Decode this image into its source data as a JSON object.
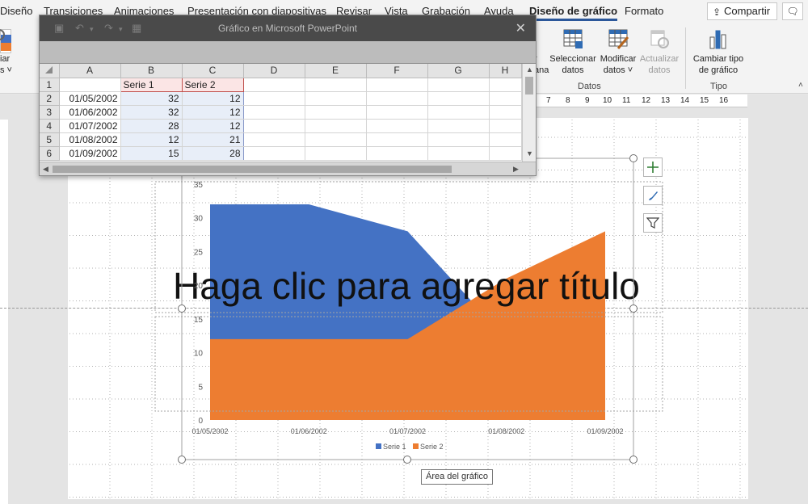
{
  "ribbon_tabs": [
    "Diseño",
    "Transiciones",
    "Animaciones",
    "Presentación con diapositivas",
    "Revisar",
    "Vista",
    "Grabación",
    "Ayuda",
    "Diseño de gráfico",
    "Formato"
  ],
  "active_tab": "Diseño de gráfico",
  "share_label": "Compartir",
  "ribbon": {
    "left_partial_label_1": "iar",
    "left_partial_label_2": "s ˅",
    "partial_label": "r",
    "partial_label_2": "ana",
    "select_data_label": "Seleccionar datos",
    "edit_data_label": "Modificar datos ˅",
    "refresh_data_label": "Actualizar datos",
    "data_group_label": "Datos",
    "change_type_label": "Cambiar tipo de gráfico",
    "type_group_label": "Tipo"
  },
  "ruler_numbers": [
    "7",
    "8",
    "9",
    "10",
    "11",
    "12",
    "13",
    "14",
    "15",
    "16"
  ],
  "spreadsheet": {
    "window_title": "Gráfico en Microsoft PowerPoint",
    "columns": [
      "A",
      "B",
      "C",
      "D",
      "E",
      "F",
      "G",
      "H"
    ],
    "row_numbers": [
      "1",
      "2",
      "3",
      "4",
      "5",
      "6"
    ],
    "header_row": [
      "",
      "Serie 1",
      "Serie 2"
    ],
    "rows": [
      [
        "01/05/2002",
        "32",
        "12"
      ],
      [
        "01/06/2002",
        "32",
        "12"
      ],
      [
        "01/07/2002",
        "28",
        "12"
      ],
      [
        "01/08/2002",
        "12",
        "21"
      ],
      [
        "01/09/2002",
        "15",
        "28"
      ]
    ]
  },
  "slide": {
    "title_placeholder": "Haga clic para agregar título",
    "chart_tooltip": "Área del gráfico"
  },
  "chart_data": {
    "type": "area",
    "categories": [
      "01/05/2002",
      "01/06/2002",
      "01/07/2002",
      "01/08/2002",
      "01/09/2002"
    ],
    "series": [
      {
        "name": "Serie 1",
        "values": [
          32,
          32,
          28,
          12,
          15
        ],
        "color": "#4472c4"
      },
      {
        "name": "Serie 2",
        "values": [
          12,
          12,
          12,
          21,
          28
        ],
        "color": "#ed7d31"
      }
    ],
    "ylim": [
      0,
      35
    ],
    "yticks": [
      "0",
      "5",
      "10",
      "15",
      "20",
      "25",
      "30",
      "35"
    ],
    "grid": true,
    "legend": "bottom"
  }
}
